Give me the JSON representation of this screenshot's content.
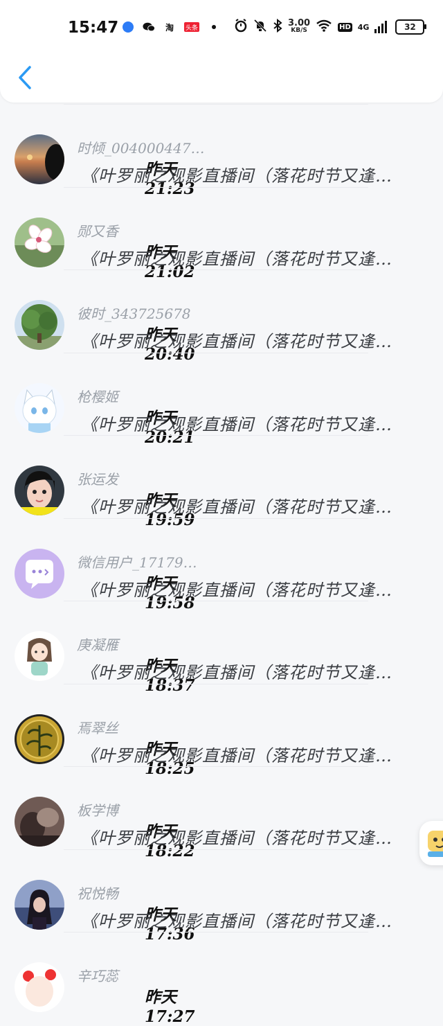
{
  "status_bar": {
    "time": "15:47",
    "net_speed_value": "3.00",
    "net_speed_unit": "KB/S",
    "hd": "HD",
    "network": "4G",
    "battery": "32",
    "taobao_label": "淘",
    "toutiao_label": "头条"
  },
  "header": {
    "back_icon": "chevron-left-icon",
    "accent": "#2b9af3"
  },
  "messages": [
    {
      "name": "时倾_004000447…",
      "time": "昨天 21:23",
      "text": "《叶罗丽之观影直播间（落花时节又逢…",
      "avatar": "sunset"
    },
    {
      "name": "郧又香",
      "time": "昨天 21:02",
      "text": "《叶罗丽之观影直播间（落花时节又逢…",
      "avatar": "blossom"
    },
    {
      "name": "彼时_343725678",
      "time": "昨天 20:40",
      "text": "《叶罗丽之观影直播间（落花时节又逢…",
      "avatar": "tree"
    },
    {
      "name": "枪樱姬",
      "time": "昨天 20:21",
      "text": "《叶罗丽之观影直播间（落花时节又逢…",
      "avatar": "anime-cat"
    },
    {
      "name": "张运发",
      "time": "昨天 19:59",
      "text": "《叶罗丽之观影直播间（落花时节又逢…",
      "avatar": "girl-portrait"
    },
    {
      "name": "微信用户_17179…",
      "time": "昨天 19:58",
      "text": "《叶罗丽之观影直播间（落花时节又逢…",
      "avatar": "chat-bubble"
    },
    {
      "name": "庚凝雁",
      "time": "昨天 18:37",
      "text": "《叶罗丽之观影直播间（落花时节又逢…",
      "avatar": "cartoon-girl"
    },
    {
      "name": "焉翠丝",
      "time": "昨天 18:25",
      "text": "《叶罗丽之观影直播间（落花时节又逢…",
      "avatar": "gold-coin"
    },
    {
      "name": "板学博",
      "time": "昨天 18:22",
      "text": "《叶罗丽之观影直播间（落花时节又逢…",
      "avatar": "dark-photo"
    },
    {
      "name": "祝悦畅",
      "time": "昨天 17:36",
      "text": "《叶罗丽之观影直播间（落花时节又逢…",
      "avatar": "night-girl"
    },
    {
      "name": "辛巧蕊",
      "time": "昨天 17:27",
      "text": "",
      "avatar": "anime-red"
    }
  ]
}
